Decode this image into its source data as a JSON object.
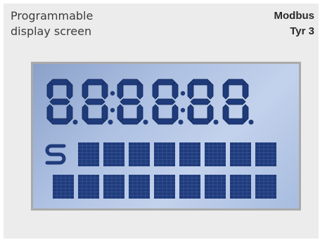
{
  "caption": {
    "line1": "Programmable",
    "line2": "display screen"
  },
  "product": {
    "line1": "Modbus",
    "line2": "Tyr 3"
  },
  "display": {
    "digits": "888888",
    "logo_icon": "s-logo-icon",
    "segment_color": "#1f3b7a",
    "background_color": "#b4c6e6",
    "matrix_row1_cells": 8,
    "matrix_row2_cells": 9
  }
}
